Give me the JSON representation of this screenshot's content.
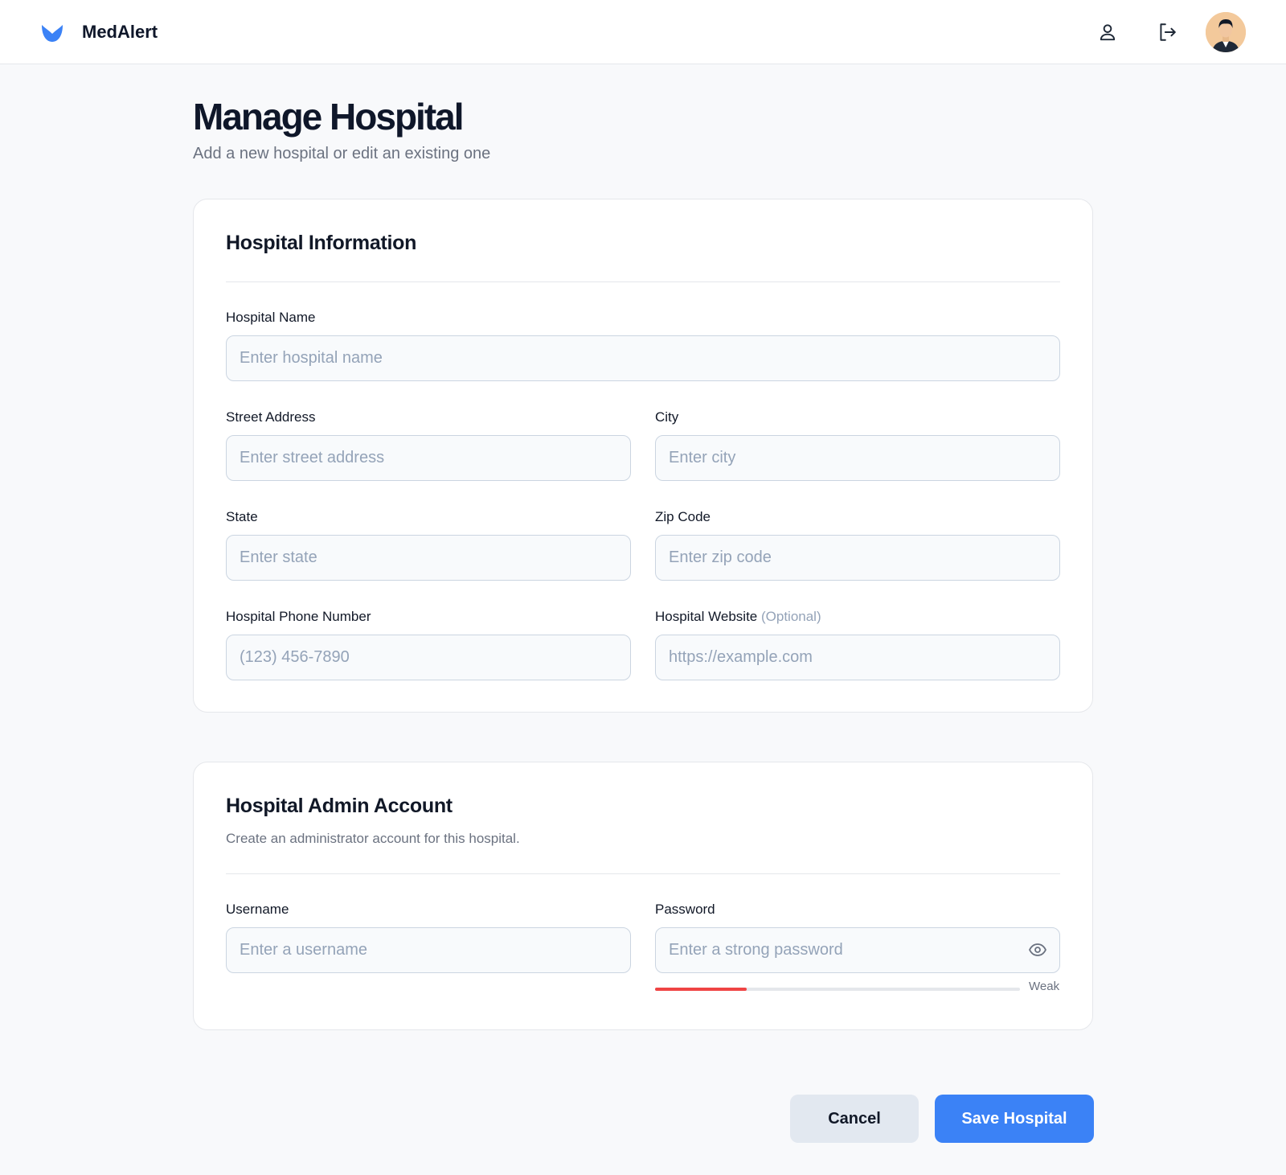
{
  "app": {
    "name": "MedAlert",
    "logo_icon": "medalert-logo-icon"
  },
  "header": {
    "profile_icon": "user-icon",
    "logout_icon": "logout-icon",
    "avatar": "user-avatar"
  },
  "page": {
    "title": "Manage Hospital",
    "subtitle": "Add a new hospital or edit an existing one"
  },
  "hospital_info": {
    "title": "Hospital Information",
    "fields": {
      "name": {
        "label": "Hospital Name",
        "placeholder": "Enter hospital name",
        "value": ""
      },
      "street": {
        "label": "Street Address",
        "placeholder": "Enter street address",
        "value": ""
      },
      "city": {
        "label": "City",
        "placeholder": "Enter city",
        "value": ""
      },
      "state": {
        "label": "State",
        "placeholder": "Enter state",
        "value": ""
      },
      "zip": {
        "label": "Zip Code",
        "placeholder": "Enter zip code",
        "value": ""
      },
      "phone": {
        "label": "Hospital Phone Number",
        "placeholder": "(123) 456-7890",
        "value": ""
      },
      "website": {
        "label": "Hospital Website",
        "optional_note": "(Optional)",
        "placeholder": "https://example.com",
        "value": ""
      }
    }
  },
  "admin_account": {
    "title": "Hospital Admin Account",
    "description": "Create an administrator account for this hospital.",
    "fields": {
      "username": {
        "label": "Username",
        "placeholder": "Enter a username",
        "value": ""
      },
      "password": {
        "label": "Password",
        "placeholder": "Enter a strong password",
        "value": "",
        "toggle_icon": "eye-icon"
      }
    },
    "password_strength": {
      "label": "Weak",
      "level": 0.25,
      "color": "#ef4444"
    }
  },
  "actions": {
    "cancel": "Cancel",
    "save": "Save Hospital"
  },
  "colors": {
    "accent": "#3b82f6",
    "weak": "#ef4444"
  }
}
